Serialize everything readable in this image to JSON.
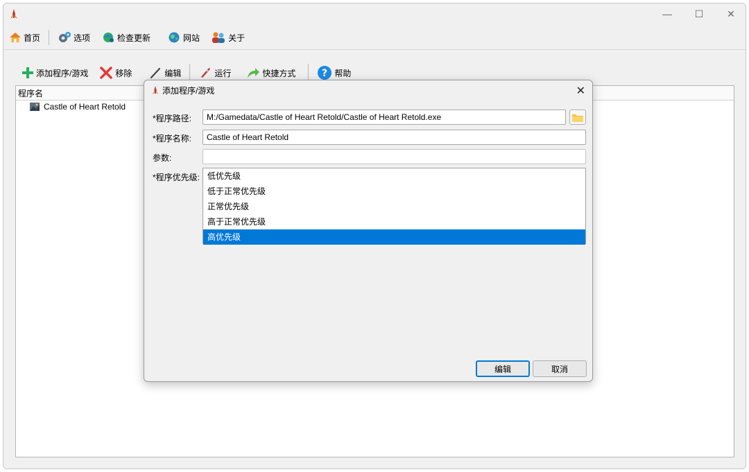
{
  "window": {
    "minimize": "—",
    "maximize": "☐",
    "close": "✕"
  },
  "menubar": {
    "home": "首页",
    "options": "选项",
    "check_update": "检查更新",
    "website": "网站",
    "about": "关于"
  },
  "toolbar": {
    "add": "添加程序/游戏",
    "remove": "移除",
    "edit": "编辑",
    "run": "运行",
    "shortcut": "快捷方式",
    "help": "帮助"
  },
  "list": {
    "column_header": "程序名",
    "rows": [
      {
        "name": "Castle of Heart Retold"
      }
    ]
  },
  "dialog": {
    "title": "添加程序/游戏",
    "path_label": "*程序路径:",
    "path_value": "M:/Gamedata/Castle of Heart Retold/Castle of Heart Retold.exe",
    "name_label": "*程序名称:",
    "name_value": "Castle of Heart Retold",
    "args_label": "参数:",
    "args_value": "",
    "priority_label": "*程序优先级:",
    "priority_options": [
      "低优先级",
      "低于正常优先级",
      "正常优先级",
      "高于正常优先级",
      "高优先级"
    ],
    "priority_selected": "高优先级",
    "ok_button": "编辑",
    "cancel_button": "取消"
  },
  "colors": {
    "accent": "#0078d7",
    "window_bg": "#f0f0f0"
  }
}
